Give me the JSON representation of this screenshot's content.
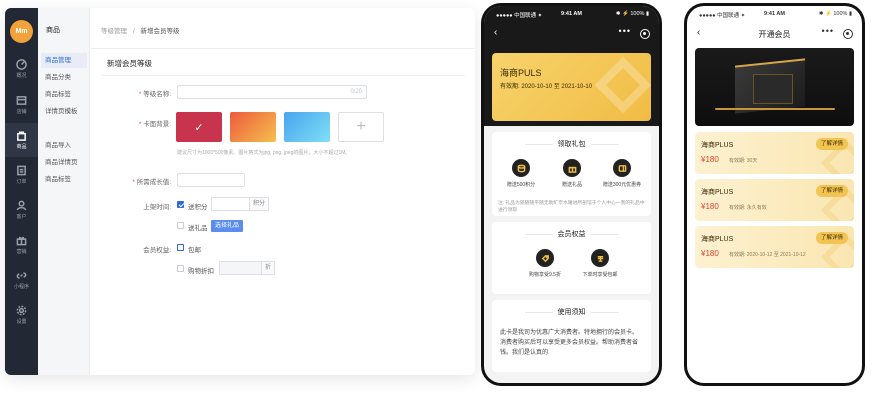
{
  "admin": {
    "logo_text": "Mm",
    "nav": [
      {
        "label": "概况",
        "icon": "dashboard-icon"
      },
      {
        "label": "店铺",
        "icon": "store-icon"
      },
      {
        "label": "商品",
        "icon": "bag-icon",
        "active": true
      },
      {
        "label": "订单",
        "icon": "order-icon"
      },
      {
        "label": "客户",
        "icon": "user-icon"
      },
      {
        "label": "营销",
        "icon": "gift-icon"
      },
      {
        "label": "小程序",
        "icon": "link-icon"
      },
      {
        "label": "设置",
        "icon": "gear-icon"
      }
    ],
    "sub_title": "商品",
    "sub_items": [
      "商品管理",
      "商品分类",
      "商品标签",
      "详情页模板",
      "商品导入",
      "商品详情页",
      "商品标签"
    ],
    "breadcrumb": {
      "parent": "等级管理",
      "sep": "/",
      "current": "新增会员等级"
    },
    "section_title": "新增会员等级",
    "form": {
      "level_name_label": "等级名称:",
      "level_name_count": "0/20",
      "card_bg_label": "卡面背景:",
      "card_bg_hint": "建议尺寸为1000*500像素。图片格式为jpg, png, jpeg的图片，大小不超过1M。",
      "growth_label": "所需成长值:",
      "gift_label": "上架时间:",
      "gift_points": "送积分",
      "gift_points_unit": "积分",
      "gift_item": "送礼品",
      "gift_choose_btn": "选择礼品",
      "rights_label": "会员权益:",
      "rights_shipping": "包邮",
      "rights_discount": "购物折扣",
      "rights_discount_unit": "折"
    },
    "colors": {
      "swatch1": "#c8334d",
      "swatch2": "#f27a3c",
      "swatch3": "#55aef0"
    }
  },
  "phone1": {
    "status": {
      "carrier": "●●●●● 中国联通 ✦",
      "time": "9:41 AM",
      "right": "✱ ⚡ 100% ▮"
    },
    "card_name": "海商PULS",
    "validity": "有效期:   2020-10-10 至 2021-10-10",
    "gift_pack": {
      "title": "领取礼包",
      "items": [
        {
          "label": "赠送500积分",
          "icon": "coin-icon"
        },
        {
          "label": "赠送礼品",
          "icon": "gift-icon"
        },
        {
          "label": "赠送300元优惠券",
          "icon": "coupon-icon"
        }
      ],
      "note": "注: 礼品为随随随平随无助旷奈水睡进所剖馆于个人中心一我的礼品中进行领取"
    },
    "rights": {
      "title": "会员权益",
      "items": [
        {
          "label": "购物享受9.5折",
          "icon": "discount-icon"
        },
        {
          "label": "下单时享受包邮",
          "icon": "shipping-icon"
        }
      ]
    },
    "notice": {
      "title": "使用须知",
      "text": "此卡是我司为优惠广大消费者。特地拥行的会员卡。消费者购买后可以享受更多会员权益。帮助消费者省钱。我们是认真的"
    }
  },
  "phone2": {
    "status": {
      "carrier": "●●●●● 中国联通 ✦",
      "time": "9:41 AM",
      "right": "✱ ⚡ 100% ▮"
    },
    "title": "开通会员",
    "plans": [
      {
        "name": "海商PLUS",
        "price": "¥180",
        "validity": "有效期: 30天",
        "detail": "了解详情"
      },
      {
        "name": "海商PLUS",
        "price": "¥180",
        "validity": "有效期: 永久有效",
        "detail": "了解详情"
      },
      {
        "name": "海商PLUS",
        "price": "¥180",
        "validity": "有效期: 2020-10-12 至 2021-10-12",
        "detail": "了解详情"
      }
    ]
  }
}
